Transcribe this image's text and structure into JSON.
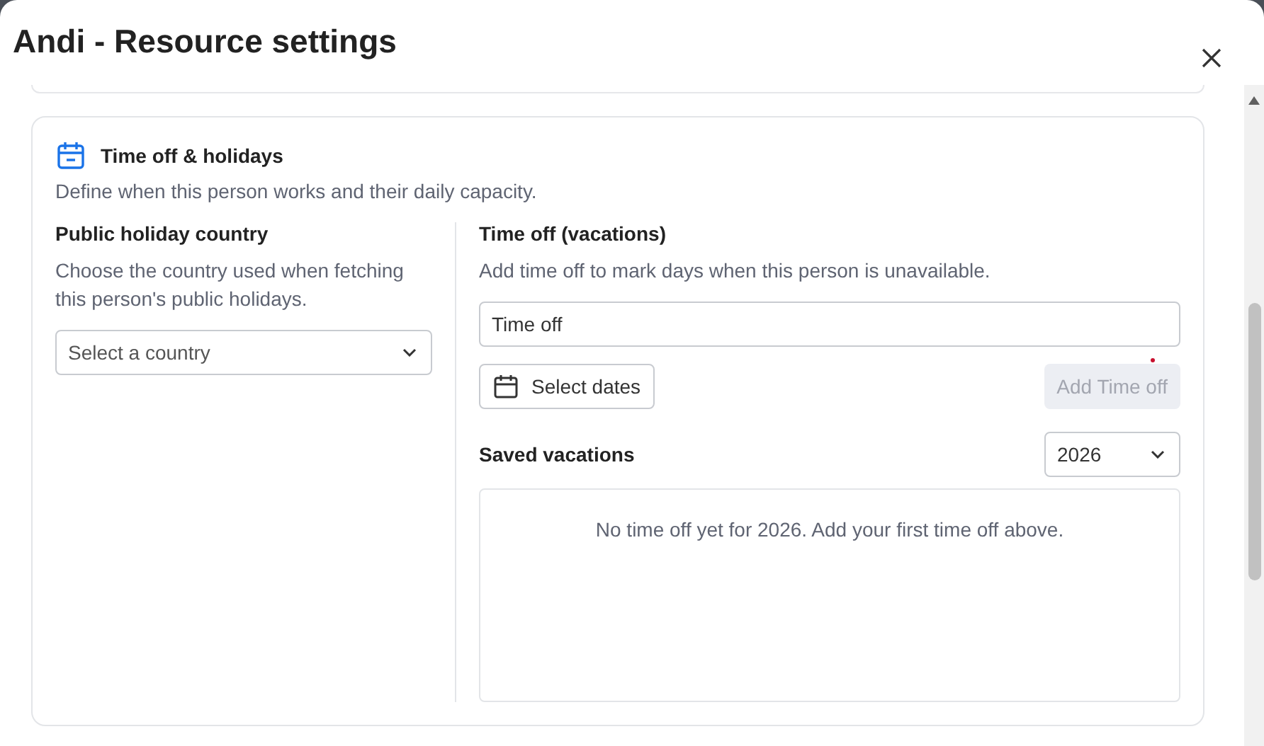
{
  "dialog": {
    "title": "Andi - Resource settings"
  },
  "section": {
    "title": "Time off & holidays",
    "description": "Define when this person works and their daily capacity."
  },
  "holiday": {
    "title": "Public holiday country",
    "description": "Choose the country used when fetching this person's public holidays.",
    "country_select": {
      "placeholder": "Select a country"
    }
  },
  "time_off": {
    "title": "Time off (vacations)",
    "description": "Add time off to mark days when this person is unavailable.",
    "name_field": {
      "value": "Time off"
    },
    "select_dates_button": "Select dates",
    "add_button": {
      "label": "Add Time off",
      "disabled": true
    }
  },
  "saved": {
    "title": "Saved vacations",
    "year_select": {
      "value": "2026"
    },
    "empty_message": "No time off yet for 2026. Add your first time off above."
  }
}
